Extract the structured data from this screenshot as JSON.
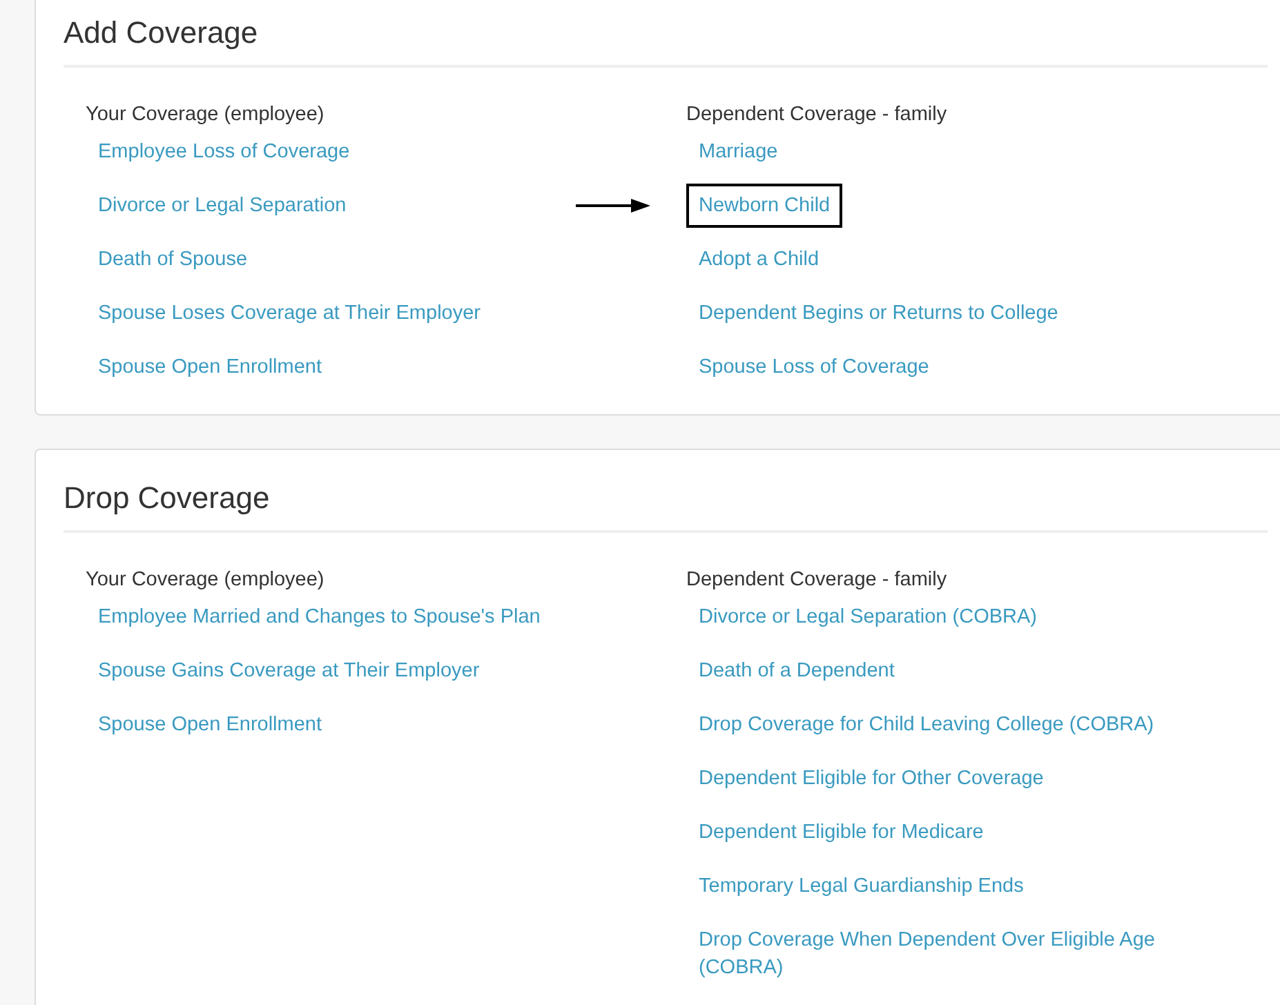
{
  "sections": [
    {
      "title": "Add Coverage",
      "columns": [
        {
          "heading": "Your Coverage (employee)",
          "links": [
            {
              "label": "Employee Loss of Coverage",
              "highlighted": false
            },
            {
              "label": "Divorce or Legal Separation",
              "highlighted": false
            },
            {
              "label": "Death of Spouse",
              "highlighted": false
            },
            {
              "label": "Spouse Loses Coverage at Their Employer",
              "highlighted": false
            },
            {
              "label": "Spouse Open Enrollment",
              "highlighted": false
            }
          ]
        },
        {
          "heading": "Dependent Coverage - family",
          "links": [
            {
              "label": "Marriage",
              "highlighted": false
            },
            {
              "label": "Newborn Child",
              "highlighted": true
            },
            {
              "label": "Adopt a Child",
              "highlighted": false
            },
            {
              "label": "Dependent Begins or Returns to College",
              "highlighted": false
            },
            {
              "label": "Spouse Loss of Coverage",
              "highlighted": false
            }
          ]
        }
      ]
    },
    {
      "title": "Drop Coverage",
      "columns": [
        {
          "heading": "Your Coverage (employee)",
          "links": [
            {
              "label": "Employee Married and Changes to Spouse's Plan",
              "highlighted": false
            },
            {
              "label": "Spouse Gains Coverage at Their Employer",
              "highlighted": false
            },
            {
              "label": "Spouse Open Enrollment",
              "highlighted": false
            }
          ]
        },
        {
          "heading": "Dependent Coverage - family",
          "links": [
            {
              "label": "Divorce or Legal Separation (COBRA)",
              "highlighted": false
            },
            {
              "label": "Death of a Dependent",
              "highlighted": false
            },
            {
              "label": "Drop Coverage for Child Leaving College (COBRA)",
              "highlighted": false
            },
            {
              "label": "Dependent Eligible for Other Coverage",
              "highlighted": false
            },
            {
              "label": "Dependent Eligible for Medicare",
              "highlighted": false
            },
            {
              "label": "Temporary Legal Guardianship Ends",
              "highlighted": false
            },
            {
              "label": "Drop Coverage When Dependent Over Eligible Age (COBRA)",
              "highlighted": false
            }
          ]
        }
      ]
    }
  ]
}
